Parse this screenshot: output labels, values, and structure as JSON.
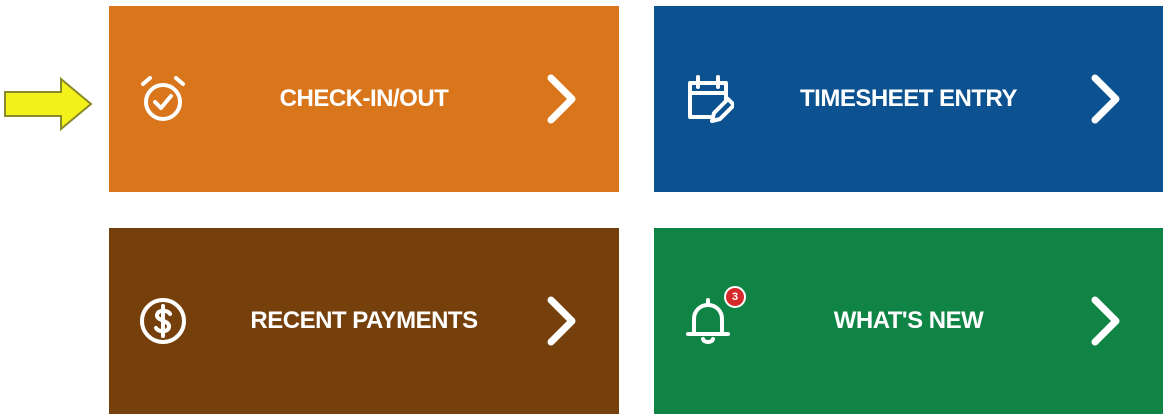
{
  "tiles": [
    {
      "id": "checkin",
      "label": "CHECK-IN/OUT",
      "icon": "alarm-clock-check-icon",
      "color": "#d9761b"
    },
    {
      "id": "timesheet",
      "label": "TIMESHEET ENTRY",
      "icon": "calendar-edit-icon",
      "color": "#0c5290"
    },
    {
      "id": "payments",
      "label": "RECENT PAYMENTS",
      "icon": "dollar-circle-icon",
      "color": "#75400c"
    },
    {
      "id": "whatsnew",
      "label": "WHAT'S NEW",
      "icon": "bell-icon",
      "color": "#0f8445"
    }
  ],
  "notifications": {
    "count": "3",
    "badge_color": "#d62a2a"
  },
  "pointer": {
    "color": "#f2f21a",
    "outline": "#8a8a2a"
  }
}
